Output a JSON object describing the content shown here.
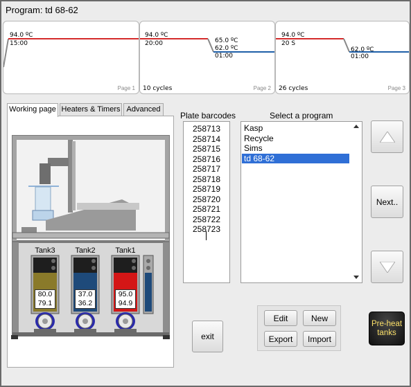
{
  "window": {
    "title": "Program: td 68-62"
  },
  "profile": {
    "stages": [
      {
        "labels": [
          "94.0 ºC",
          "15:00"
        ],
        "cycles": "",
        "page": "Page 1"
      },
      {
        "labels": [
          "94.0 ºC",
          "20:00",
          "65.0 ºC",
          "62.0 ºC",
          "01:00"
        ],
        "cycles": "10 cycles",
        "page": "Page 2"
      },
      {
        "labels": [
          "94.0 ºC",
          "20 S",
          "62.0 ºC",
          "01:00"
        ],
        "cycles": "26 cycles",
        "page": "Page 3"
      }
    ],
    "colors": {
      "denature": "#d42a2a",
      "anneal": "#1e5fa8",
      "ramp": "#888888"
    }
  },
  "tabs": [
    "Working page",
    "Heaters & Timers",
    "Advanced"
  ],
  "machine": {
    "tanks": [
      {
        "name": "Tank3",
        "set": "80.0",
        "actual": "79.1",
        "color": "#8a7a2a"
      },
      {
        "name": "Tank2",
        "set": "37.0",
        "actual": "36.2",
        "color": "#1e4a7a"
      },
      {
        "name": "Tank1",
        "set": "95.0",
        "actual": "94.9",
        "color": "#d41616"
      }
    ]
  },
  "barcodes": {
    "label": "Plate barcodes",
    "items": [
      "258713",
      "258714",
      "258715",
      "258716",
      "258717",
      "258718",
      "258719",
      "258720",
      "258721",
      "258722",
      "258723"
    ]
  },
  "programs": {
    "label": "Select a program",
    "items": [
      "Kasp",
      "Recycle",
      "Sims",
      "td 68-62"
    ],
    "selected": "td 68-62"
  },
  "buttons": {
    "next": "Next..",
    "exit": "exit",
    "edit": "Edit",
    "new": "New",
    "export": "Export",
    "import": "Import",
    "preheat_line1": "Pre-heat",
    "preheat_line2": "tanks"
  }
}
